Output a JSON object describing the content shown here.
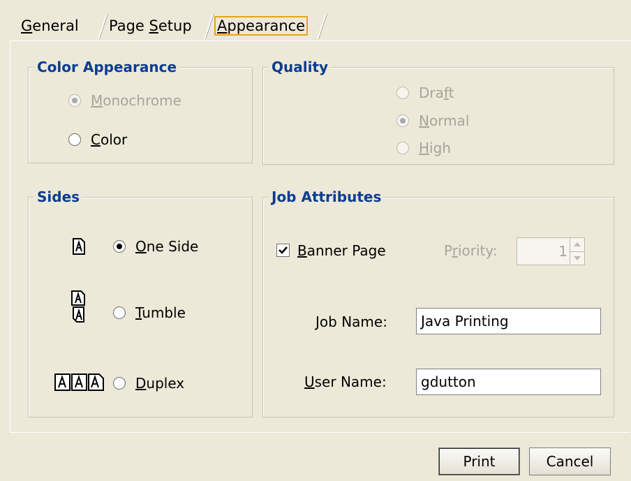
{
  "tabs": [
    {
      "label": "General",
      "mnemonic": "G",
      "rest": "eneral",
      "selected": false
    },
    {
      "label": "Page Setup",
      "pre": "Page ",
      "mnemonic": "S",
      "rest": "etup",
      "selected": false
    },
    {
      "label": "Appearance",
      "mnemonic": "A",
      "rest": "ppearance",
      "selected": true
    }
  ],
  "color_appearance": {
    "title": "Color Appearance",
    "options": [
      {
        "mn": "M",
        "rest": "onochrome",
        "selected": true,
        "enabled": false
      },
      {
        "mn": "C",
        "rest": "olor",
        "selected": false,
        "enabled": true
      }
    ]
  },
  "quality": {
    "title": "Quality",
    "options": [
      {
        "pre": "Dra",
        "mn": "f",
        "rest": "t",
        "selected": false,
        "enabled": false
      },
      {
        "pre": "",
        "mn": "N",
        "rest": "ormal",
        "selected": true,
        "enabled": false
      },
      {
        "pre": "",
        "mn": "H",
        "rest": "igh",
        "selected": false,
        "enabled": false
      }
    ]
  },
  "sides": {
    "title": "Sides",
    "options": [
      {
        "mn": "O",
        "rest": "ne Side",
        "selected": true,
        "icon": "one-side-page-icon"
      },
      {
        "mn": "T",
        "rest": "umble",
        "selected": false,
        "icon": "tumble-pages-icon"
      },
      {
        "mn": "D",
        "rest": "uplex",
        "selected": false,
        "icon": "duplex-pages-icon"
      }
    ]
  },
  "job_attributes": {
    "title": "Job Attributes",
    "banner_page": {
      "mn": "B",
      "rest": "anner Page",
      "checked": true
    },
    "priority": {
      "pre": "P",
      "mn": "r",
      "rest": "iority:",
      "value": "1"
    },
    "job_name": {
      "mn": "J",
      "rest": "ob Name:",
      "value": "Java Printing"
    },
    "user_name": {
      "mn": "U",
      "rest": "ser Name:",
      "value": "gdutton"
    }
  },
  "buttons": {
    "print": "Print",
    "cancel": "Cancel"
  }
}
